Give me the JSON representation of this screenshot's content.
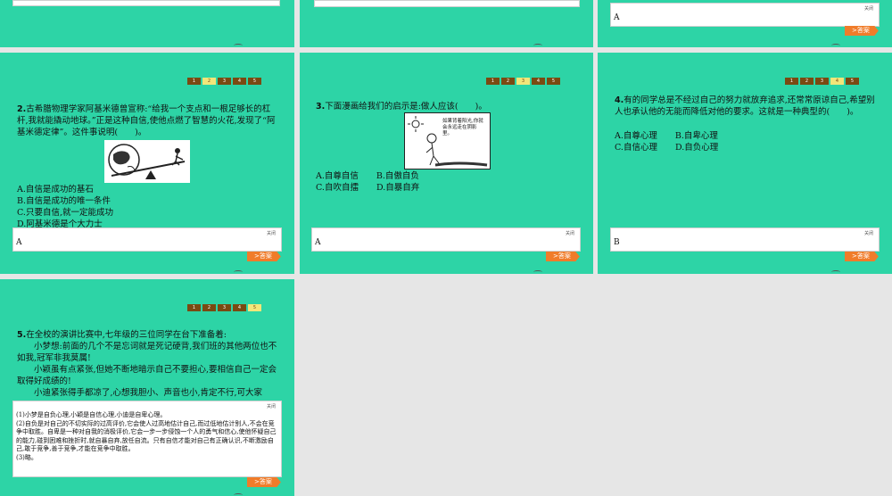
{
  "pager": [
    "1",
    "2",
    "3",
    "4",
    "5"
  ],
  "close_label": "关闭",
  "answer_button": "答案",
  "top": {
    "ans3": "A"
  },
  "q2": {
    "number": "2.",
    "text": "古希腊物理学家阿基米德曾宣称:“给我一个支点和一根足够长的杠杆,我就能撬动地球。”正是这种自信,使他点燃了智慧的火花,发现了“阿基米德定律”。这件事说明(　　)。",
    "options": [
      "A.自信是成功的基石",
      "B.自信是成功的唯一条件",
      "C.只要自信,就一定能成功",
      "D.阿基米德是个大力士"
    ],
    "answer": "A"
  },
  "q3": {
    "number": "3.",
    "text": "下面漫画给我们的启示是:做人应该(　　)。",
    "cartoon_text": "如果背着阳光,你就会永远走在阴影里。",
    "options": [
      "A.自尊自信",
      "B.自傲自负",
      "C.自吹自擂",
      "D.自暴自弃"
    ],
    "answer": "A"
  },
  "q4": {
    "number": "4.",
    "text": "有的同学总是不经过自己的努力就放弃追求,还常常原谅自己,希望别人也承认他的无能而降低对他的要求。这就是一种典型的(　　)。",
    "options": [
      "A.自尊心理",
      "B.自卑心理",
      "C.自信心理",
      "D.自负心理"
    ],
    "answer": "B"
  },
  "q5": {
    "number": "5.",
    "lines": [
      "在全校的演讲比赛中,七年级的三位同学在台下准备着:",
      "小梦想:前面的几个不是忘词就是死记硬背,我们班的其他两位也不如我,冠军非我莫属!",
      "小颖虽有点紧张,但她不断地暗示自己不要担心,要相信自己一定会取得好成绩的!",
      "小迪紧张得手都凉了,心想我胆小、声音也小,肯定不行,可大家"
    ],
    "answer_lines": [
      "(1)小梦是自负心理,小颖是自信心理,小迪是自卑心理。",
      "(2)自负是对自己的不切实际的过高评价,它会使人过高地估计自己,而过低地估计别人,不会在竞争中取胜。自卑是一种对自我的消极评价,它会一步一步侵蚀一个人的勇气和信心,使他怀疑自己的能力,碰到困难和挫折时,就自暴自弃,放任自流。只有自信才能对自己有正确认识,不断激励自己,敢于竞争,善于竞争,才能在竞争中取胜。",
      "(3)略。"
    ]
  }
}
